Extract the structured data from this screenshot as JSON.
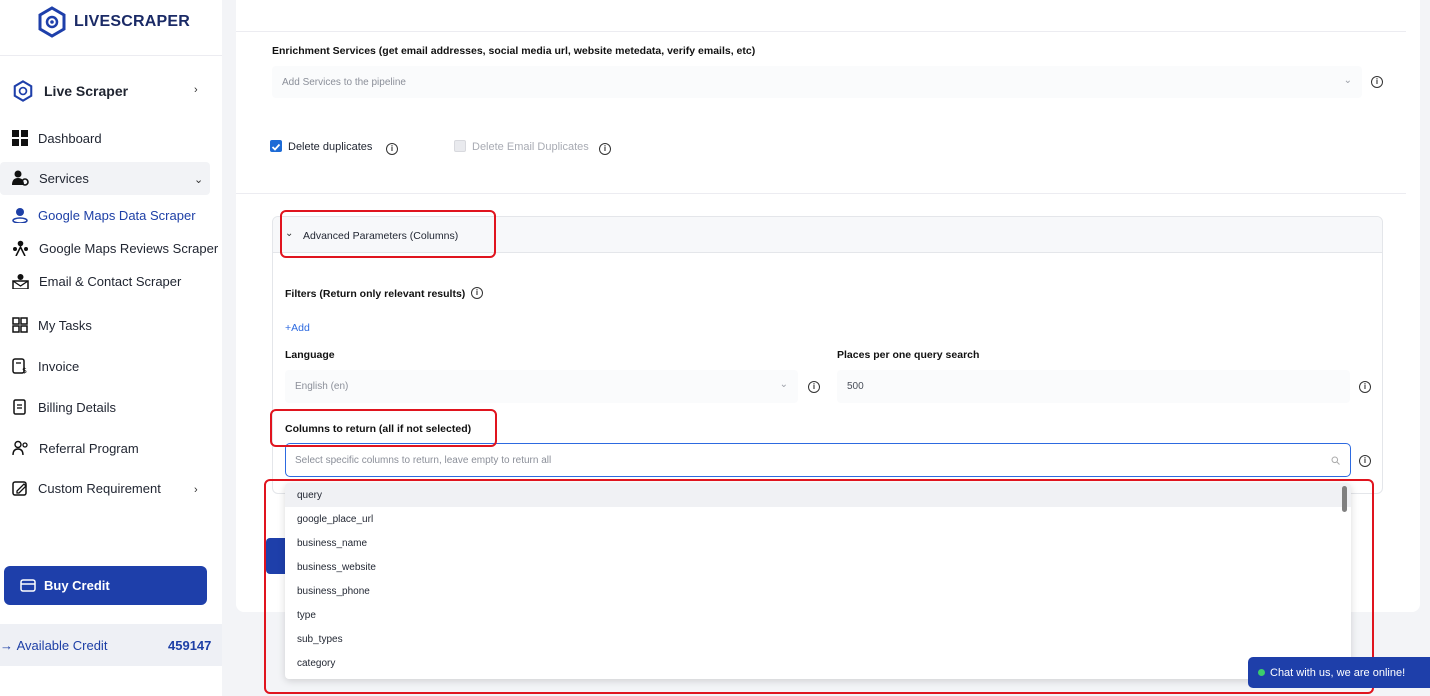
{
  "app": {
    "brand": "LIVESCRAPER"
  },
  "sidebar": {
    "live_scraper": "Live Scraper",
    "dashboard": "Dashboard",
    "services": "Services",
    "sub_items": [
      "Google Maps Data Scraper",
      "Google Maps Reviews Scraper",
      "Email & Contact Scraper"
    ],
    "my_tasks": "My Tasks",
    "invoice": "Invoice",
    "billing": "Billing Details",
    "referral": "Referral Program",
    "custom": "Custom Requirement",
    "buy_credit": "Buy Credit",
    "available_credit_label": "Available Credit",
    "available_credit_value": "459147"
  },
  "form": {
    "enrichment_label": "Enrichment Services (get email addresses, social media url, website metedata, verify emails, etc)",
    "enrichment_placeholder": "Add Services to the pipeline",
    "delete_duplicates": "Delete duplicates",
    "delete_duplicates_checked": true,
    "delete_email_duplicates": "Delete Email Duplicates",
    "delete_email_duplicates_checked": false,
    "advanced_title": "Advanced Parameters (Columns)",
    "filters_label": "Filters (Return only relevant results)",
    "add_link": "+Add",
    "language_label": "Language",
    "language_value": "English (en)",
    "places_label": "Places per one query search",
    "places_value": "500",
    "columns_label": "Columns to return (all if not selected)",
    "columns_placeholder": "Select specific columns to return, leave empty to return all",
    "column_options": [
      "query",
      "google_place_url",
      "business_name",
      "business_website",
      "business_phone",
      "type",
      "sub_types",
      "category"
    ]
  },
  "chat": {
    "text": "Chat with us, we are online!"
  },
  "colors": {
    "primary": "#1e3faa",
    "highlight_red": "#e0141e",
    "link": "#2d6ae0"
  }
}
